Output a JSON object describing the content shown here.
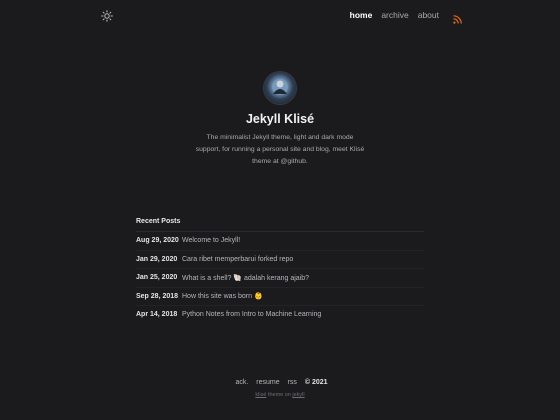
{
  "nav": {
    "links": [
      {
        "label": "home"
      },
      {
        "label": "archive"
      },
      {
        "label": "about"
      }
    ],
    "icons": {
      "theme": "sun-icon",
      "rss": "rss-icon"
    }
  },
  "profile": {
    "title": "Jekyll Klisé",
    "description": "The minimalist Jekyll theme, light and dark mode support, for running a personal site and blog, meet Klisé theme at @github."
  },
  "recent": {
    "heading": "Recent Posts",
    "posts": [
      {
        "date": "Aug 29, 2020",
        "title": "Welcome to Jekyll!"
      },
      {
        "date": "Jan 29, 2020",
        "title": "Cara ribet memperbarui forked repo"
      },
      {
        "date": "Jan 25, 2020",
        "title": "What is a shell? 🐚 adalah kerang ajaib?"
      },
      {
        "date": "Sep 28, 2018",
        "title": "How this site was born 👶"
      },
      {
        "date": "Apr 14, 2018",
        "title": "Python Notes from Intro to Machine Learning"
      }
    ]
  },
  "footer": {
    "links": [
      "ack.",
      "resume",
      "rss"
    ],
    "copyright": "© 2021",
    "credit_theme": "klisé",
    "credit_middle": " theme on ",
    "credit_engine": "jekyll"
  },
  "colors": {
    "background": "#1b1b1e",
    "rss": "#e86a1c"
  }
}
